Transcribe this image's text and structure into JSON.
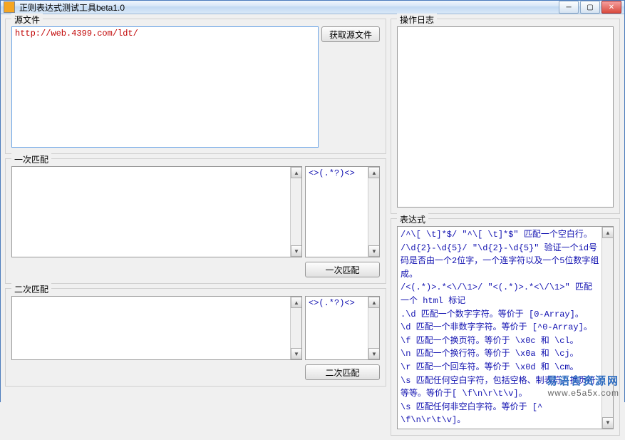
{
  "window": {
    "title": "正则表达式测试工具beta1.0"
  },
  "source": {
    "label": "源文件",
    "button": "获取源文件",
    "value": "http://web.4399.com/ldt/"
  },
  "once": {
    "label": "一次匹配",
    "button": "一次匹配",
    "pattern": "<>(.*?)<>"
  },
  "twice": {
    "label": "二次匹配",
    "button": "二次匹配",
    "pattern": "<>(.*?)<>"
  },
  "log": {
    "label": "操作日志"
  },
  "expr": {
    "label": "表达式",
    "lines": [
      "/^\\[ \\t]*$/ \"^\\[ \\t]*$\" 匹配一个空白行。",
      "/\\d{2}-\\d{5}/ \"\\d{2}-\\d{5}\" 验证一个id号码是否由一个2位字，一个连字符以及一个5位数字组成。",
      "/<(.*)>.*<\\/\\1>/ \"<(.*)>.*<\\/\\1>\" 匹配一个 html 标记",
      ".\\d 匹配一个数字字符。等价于 [0-Array]。",
      "\\d 匹配一个非数字字符。等价于 [^0-Array]。",
      "\\f 匹配一个换页符。等价于 \\x0c 和 \\cl。",
      "\\n 匹配一个换行符。等价于 \\x0a 和 \\cj。",
      "\\r 匹配一个回车符。等价于 \\x0d 和 \\cm。",
      "\\s 匹配任何空白字符，包括空格、制表符、换页符等等。等价于[ \\f\\n\\r\\t\\v]。",
      "\\s 匹配任何非空白字符。等价于 [^ \\f\\n\\r\\t\\v]。"
    ]
  },
  "watermark": {
    "cn": "易语言资源网",
    "en": "www.e5a5x.com"
  }
}
